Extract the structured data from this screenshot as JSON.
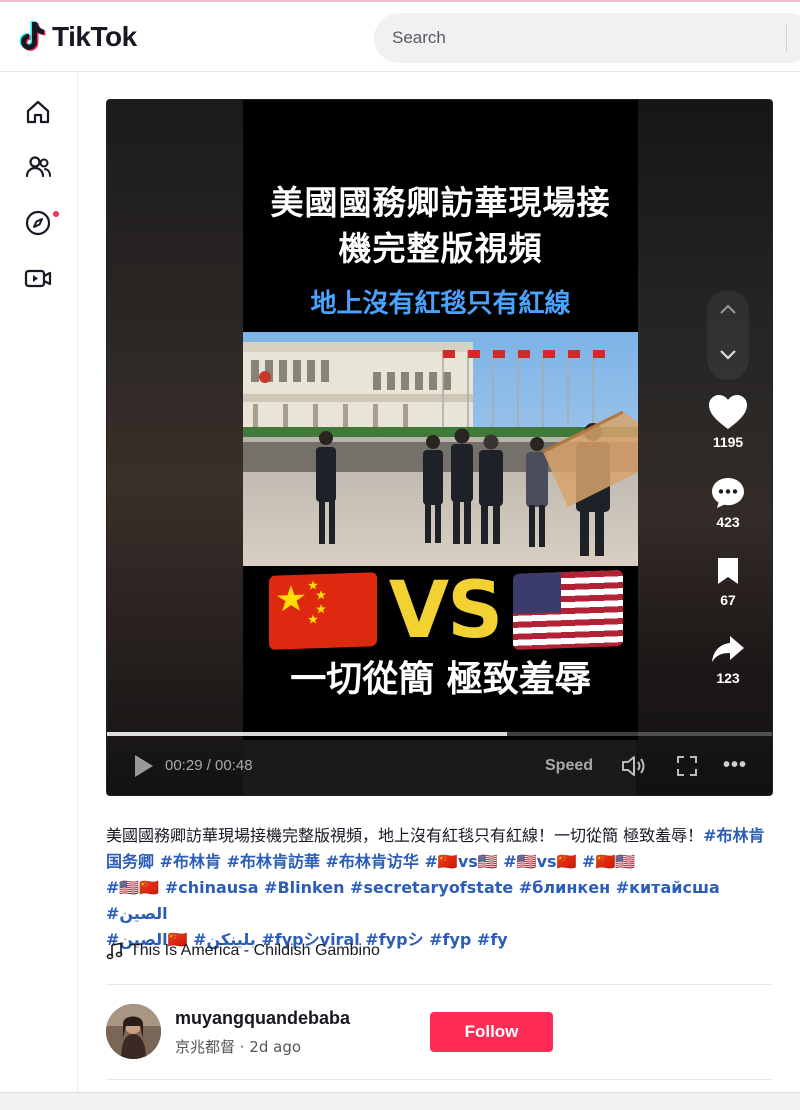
{
  "app": {
    "name": "TikTok"
  },
  "search": {
    "placeholder": "Search"
  },
  "sidebar": {
    "items": [
      {
        "icon": "home-icon"
      },
      {
        "icon": "following-icon"
      },
      {
        "icon": "explore-icon",
        "has_dot": true
      },
      {
        "icon": "live-icon"
      }
    ]
  },
  "video": {
    "overlay_title": "美國國務卿訪華現場接機完整版視頻",
    "overlay_title_line1": "美國國務卿訪華現場接",
    "overlay_title_line2": "機完整版視頻",
    "overlay_subtitle": "地上沒有紅毯只有紅線",
    "overlay_vs": "VS",
    "overlay_bottom": "一切從簡 極致羞辱",
    "progress": 0.6,
    "time": "00:29 / 00:48",
    "speed_label": "Speed",
    "actions": {
      "likes": "1195",
      "comments": "423",
      "saves": "67",
      "shares": "123"
    },
    "colors": {
      "subtitle": "#4aa3ff",
      "vs": "#f2d233",
      "accent": "#fe2c55"
    }
  },
  "caption": {
    "text_line": "美國國務卿訪華現場接機完整版視頻，地上沒有紅毯只有紅線！一切從簡 極致羞辱！",
    "tags_1": "#布林肯国务卿 #布林肯 #布林肯訪華 #布林肯访华 #🇨🇳vs🇺🇸 #🇺🇸vs🇨🇳 #🇨🇳🇺🇸",
    "tags_2": "#🇺🇸🇨🇳 #chinausa #Blinken #secretaryofstate #блинкен #китайсша #الصين",
    "tags_3": "#الصين🇨🇳 #بلينكن #fypシviral #fypシ #fyp #fy"
  },
  "music": {
    "title": "This Is America - Childish Gambino"
  },
  "author": {
    "username": "muyangquandebaba",
    "nickname": "京兆都督",
    "time_ago": "2d ago",
    "meta": "京兆都督 · 2d ago"
  },
  "follow": {
    "label": "Follow"
  }
}
